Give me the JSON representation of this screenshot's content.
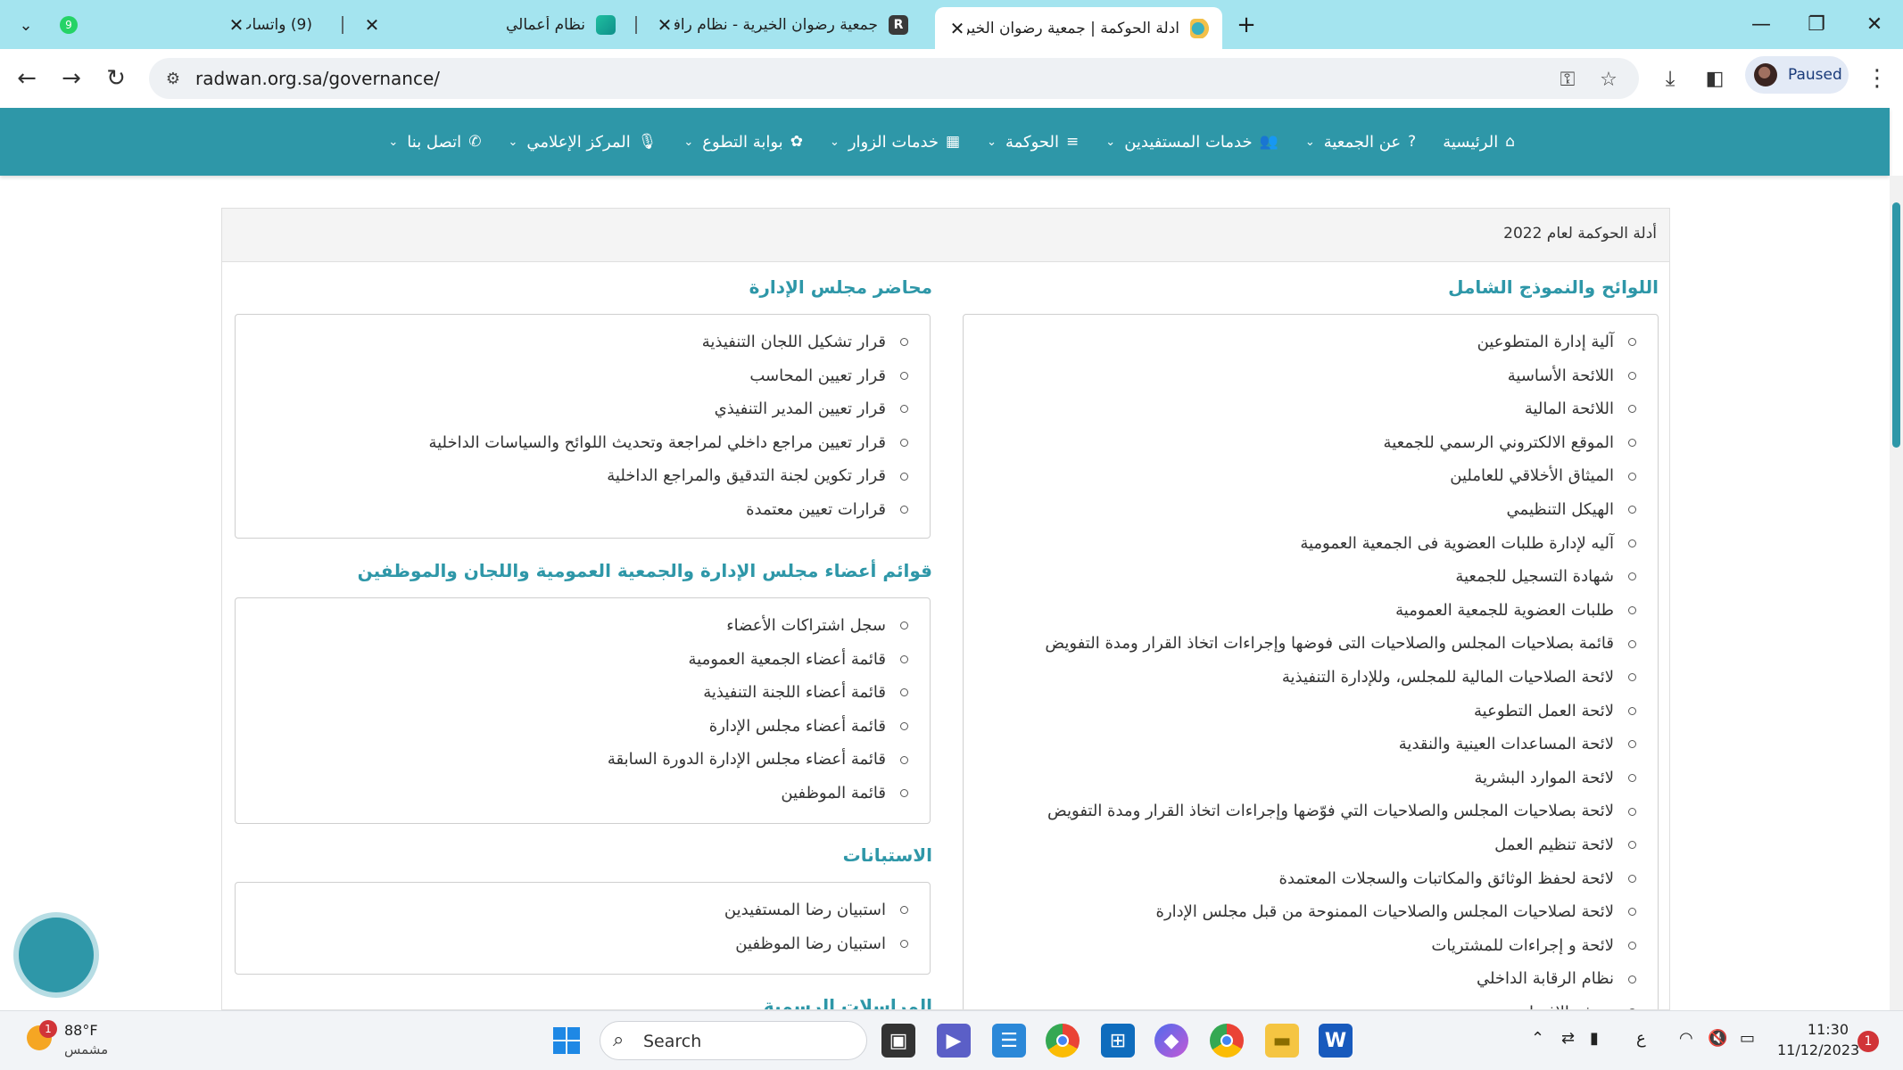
{
  "browser": {
    "tabs": [
      {
        "title": "(9) واتساب",
        "icon": "whatsapp-icon",
        "active": false
      },
      {
        "title": "نظام أعمالي",
        "icon": "amali-icon",
        "active": false
      },
      {
        "title": "جمعية رضوان الخيرية - نظام رافد",
        "icon": "rafed-icon",
        "active": false
      },
      {
        "title": "ادلة الحوكمة | جمعية رضوان الخير",
        "icon": "radwan-icon",
        "active": true
      }
    ],
    "url": "radwan.org.sa/governance/",
    "profile_label": "Paused"
  },
  "site_nav": [
    {
      "label": "الرئيسية",
      "icon": "home-icon",
      "dropdown": false
    },
    {
      "label": "عن الجمعية",
      "icon": "question-icon",
      "dropdown": true
    },
    {
      "label": "خدمات المستفيدين",
      "icon": "users-icon",
      "dropdown": true
    },
    {
      "label": "الحوكمة",
      "icon": "list-icon",
      "dropdown": true
    },
    {
      "label": "خدمات الزوار",
      "icon": "table-icon",
      "dropdown": true
    },
    {
      "label": "بوابة التطوع",
      "icon": "gift-icon",
      "dropdown": true
    },
    {
      "label": "المركز الإعلامي",
      "icon": "mic-icon",
      "dropdown": true
    },
    {
      "label": "اتصل بنا",
      "icon": "phone-icon",
      "dropdown": true
    }
  ],
  "card_title": "أدلة الحوكمة لعام 2022",
  "sections": {
    "regulations": {
      "title": "اللوائح والنموذج الشامل",
      "items": [
        "آلية إدارة المتطوعين",
        "اللائحة الأساسية",
        "اللائحة المالية",
        "الموقع الالكتروني الرسمي للجمعية",
        "الميثاق الأخلاقي للعاملين",
        "الهيكل التنظيمي",
        "آليه لإدارة طلبات العضوية فى الجمعية العمومية",
        "شهادة التسجيل للجمعية",
        "طلبات العضوية للجمعية العمومية",
        "قائمة بصلاحيات المجلس والصلاحيات التى فوضها وإجراءات اتخاذ القرار ومدة التفويض",
        "لائحة الصلاحيات المالية للمجلس، وللإدارة التنفيذية",
        "لائحة العمل التطوعية",
        "لائحة المساعدات العينية والنقدية",
        "لائحة الموارد البشرية",
        "لائحة بصلاحيات المجلس والصلاحيات التي فوّضها وإجراءات اتخاذ القرار ومدة التفويض",
        "لائحة تنظيم العمل",
        "لائحة لحفظ الوثائق والمكاتبات والسجلات المعتمدة",
        "لائحة لصلاحيات المجلس والصلاحيات الممنوحة من قبل مجلس الإدارة",
        "لائحة و إجراءات للمشتريات",
        "نظام الرقابة الداخلي",
        "نموذج الإفصاح"
      ]
    },
    "board_minutes": {
      "title": "محاضر مجلس الإدارة",
      "items": [
        "قرار تشكيل اللجان التنفيذية",
        "قرار تعيين المحاسب",
        "قرار تعيين المدير التنفيذي",
        "قرار تعيين مراجع داخلي لمراجعة وتحديث اللوائح والسياسات الداخلية",
        "قرار تكوين لجنة التدقيق والمراجع الداخلية",
        "قرارات تعيين معتمدة"
      ]
    },
    "member_lists": {
      "title": "قوائم أعضاء مجلس الإدارة والجمعية العمومية واللجان والموظفين",
      "items": [
        "سجل اشتراكات الأعضاء",
        "قائمة أعضاء الجمعية العمومية",
        "قائمة أعضاء اللجنة التنفيذية",
        "قائمة أعضاء مجلس الإدارة",
        "قائمة أعضاء مجلس الإدارة الدورة السابقة",
        "قائمة الموظفين"
      ]
    },
    "surveys": {
      "title": "الاستبانات",
      "items": [
        "استبيان رضا المستفيدين",
        "استبيان رضا الموظفين"
      ]
    },
    "official_correspondence": {
      "title": "المراسلات الرسمية"
    }
  },
  "taskbar": {
    "weather_temp": "88°F",
    "weather_desc": "مشمس",
    "weather_badge": "1",
    "search_label": "Search",
    "lang": "ع",
    "time": "11:30",
    "date": "11/12/2023",
    "notification_count": "1"
  },
  "colors": {
    "accent": "#2e97a8",
    "tabstrip": "#a4e4ef"
  }
}
